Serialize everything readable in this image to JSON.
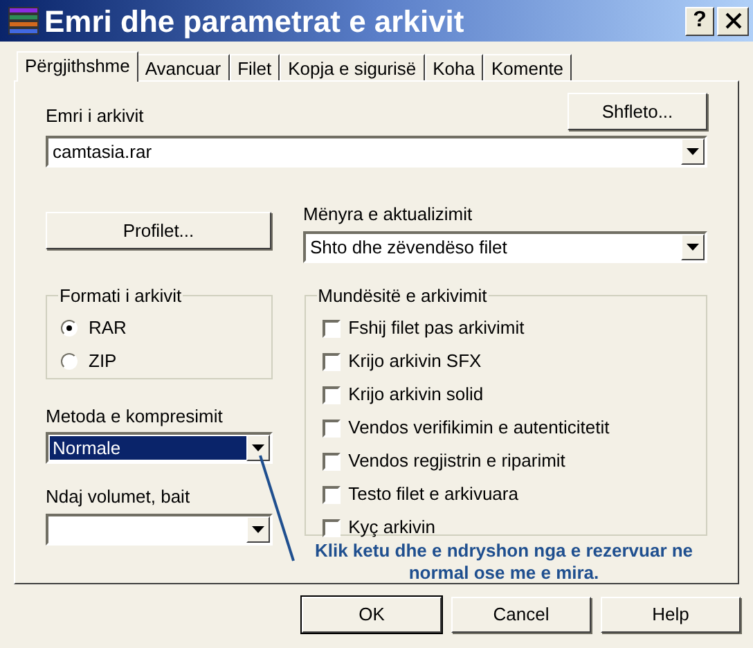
{
  "window": {
    "title": "Emri dhe parametrat e arkivit",
    "help_button": "?"
  },
  "tabs": [
    {
      "label": "Përgjithshme",
      "selected": true
    },
    {
      "label": "Avancuar",
      "selected": false
    },
    {
      "label": "Filet",
      "selected": false
    },
    {
      "label": "Kopja e sigurisë",
      "selected": false
    },
    {
      "label": "Koha",
      "selected": false
    },
    {
      "label": "Komente",
      "selected": false
    }
  ],
  "archive_name": {
    "label": "Emri i arkivit",
    "value": "camtasia.rar",
    "browse_button": "Shfleto..."
  },
  "profiles_button": "Profilet...",
  "update_mode": {
    "label": "Mënyra e aktualizimit",
    "value": "Shto dhe zëvendëso filet"
  },
  "archive_format": {
    "title": "Formati i arkivit",
    "options": [
      {
        "label": "RAR",
        "selected": true
      },
      {
        "label": "ZIP",
        "selected": false
      }
    ]
  },
  "compression_method": {
    "label": "Metoda e kompresimit",
    "value": "Normale"
  },
  "split_volumes": {
    "label": "Ndaj volumet, bait"
  },
  "archiving_options": {
    "title": "Mundësitë e arkivimit",
    "items": [
      {
        "label": "Fshij filet pas arkivimit",
        "checked": false
      },
      {
        "label": "Krijo arkivin SFX",
        "checked": false
      },
      {
        "label": "Krijo arkivin solid",
        "checked": false
      },
      {
        "label": "Vendos verifikimin e autenticitetit",
        "checked": false
      },
      {
        "label": "Vendos regjistrin e riparimit",
        "checked": false
      },
      {
        "label": "Testo filet e arkivuara",
        "checked": false
      },
      {
        "label": "Kyç arkivin",
        "checked": false
      }
    ]
  },
  "annotation": "Klik ketu dhe e ndryshon nga e rezervuar ne normal ose me e mira.",
  "buttons": [
    {
      "label": "OK",
      "default": true
    },
    {
      "label": "Cancel",
      "default": false
    },
    {
      "label": "Help",
      "default": false
    }
  ]
}
